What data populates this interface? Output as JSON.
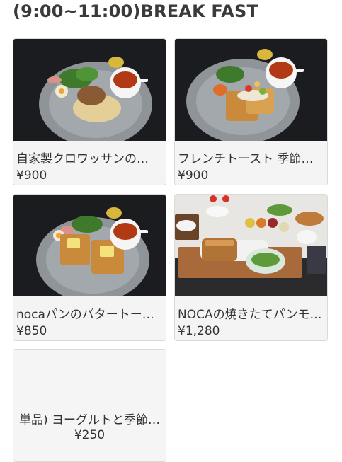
{
  "section": {
    "title": "(9:00~11:00)BREAK FAST"
  },
  "items": [
    {
      "name": "自家製クロワッサンの…",
      "price": "¥900",
      "image": "croissant-plate-photo"
    },
    {
      "name": "フレンチトースト 季節…",
      "price": "¥900",
      "image": "french-toast-plate-photo"
    },
    {
      "name": "nocaパンのバタートー…",
      "price": "¥850",
      "image": "butter-toast-plate-photo"
    },
    {
      "name": "NOCAの焼きたてパンモ…",
      "price": "¥1,280",
      "image": "bread-morning-set-photo"
    },
    {
      "name": "単品) ヨーグルトと季節…",
      "price": "¥250",
      "image": ""
    }
  ],
  "colors": {
    "card_bg": "#f4f4f4",
    "border": "#dadada",
    "text": "#333333",
    "photo_bg": "#1b1c1f"
  }
}
